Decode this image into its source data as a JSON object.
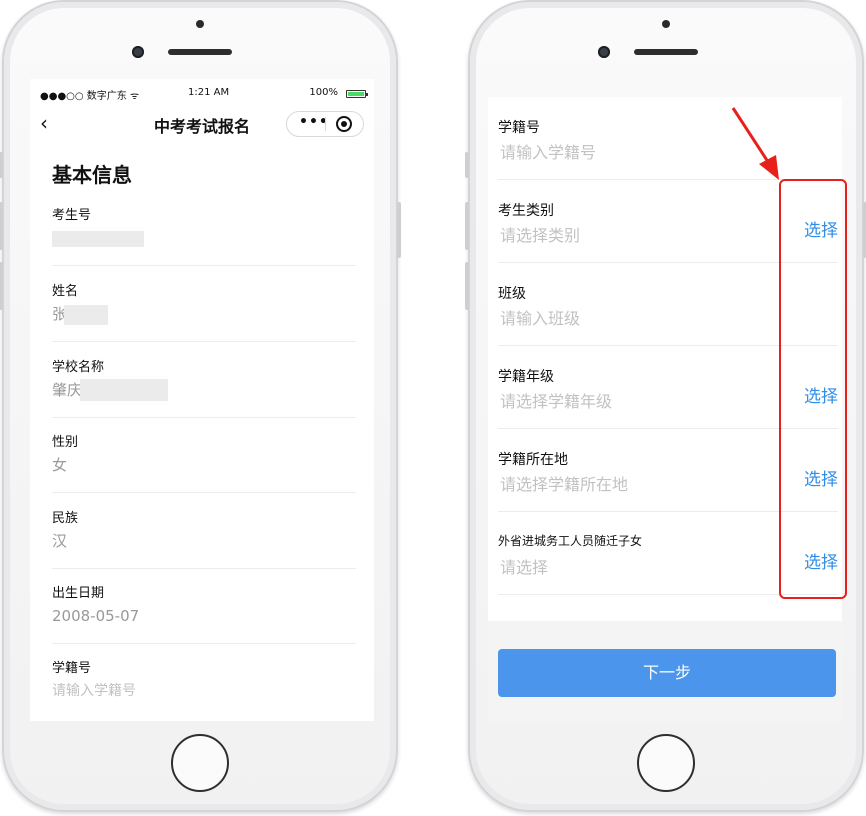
{
  "status_bar": {
    "carrier": "●●●○○ 数字广东 ᯤ",
    "time": "1:21 AM",
    "battery_pct": "100%",
    "battery_level": 1.0
  },
  "nav": {
    "back_icon": "‹",
    "title": "中考考试报名",
    "more_icon": "•••"
  },
  "left": {
    "section_title": "基本信息",
    "fields": [
      {
        "label": "考生号",
        "value": ""
      },
      {
        "label": "姓名",
        "value": "张"
      },
      {
        "label": "学校名称",
        "value": "肇庆"
      },
      {
        "label": "性别",
        "value": "女"
      },
      {
        "label": "民族",
        "value": "汉"
      },
      {
        "label": "出生日期",
        "value": "2008-05-07"
      },
      {
        "label": "学籍号",
        "placeholder": "请输入学籍号"
      }
    ]
  },
  "right": {
    "fields": [
      {
        "label": "学籍号",
        "placeholder": "请输入学籍号"
      },
      {
        "label": "考生类别",
        "placeholder": "请选择类别",
        "action": "选择"
      },
      {
        "label": "班级",
        "placeholder": "请输入班级"
      },
      {
        "label": "学籍年级",
        "placeholder": "请选择学籍年级",
        "action": "选择"
      },
      {
        "label": "学籍所在地",
        "placeholder": "请选择学籍所在地",
        "action": "选择"
      },
      {
        "label": "外省进城务工人员随迁子女",
        "placeholder": "请选择",
        "action": "选择"
      }
    ],
    "next_button": "下一步"
  },
  "colors": {
    "link": "#2f8ee8",
    "primary_button": "#4b95ec",
    "annotation": "#e8201a"
  }
}
